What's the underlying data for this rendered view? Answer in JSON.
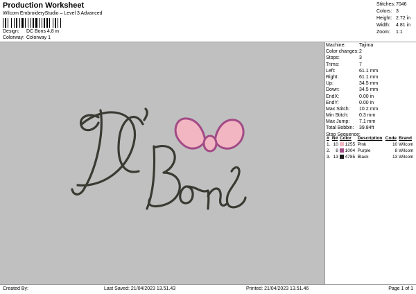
{
  "header": {
    "title": "Production Worksheet",
    "subtitle": "Wilcom EmbroideryStudio – Level 3 Advanced",
    "design_label": "Design:",
    "design_value": "DC Bons 4,8 in",
    "colorway_label": "Colorway:",
    "colorway_value": "Colorway 1"
  },
  "stats": [
    {
      "label": "Stitches:",
      "value": "7046"
    },
    {
      "label": "Colors:",
      "value": "3"
    },
    {
      "label": "Height:",
      "value": "2.72 in"
    },
    {
      "label": "Width:",
      "value": "4.81 in"
    },
    {
      "label": "Zoom:",
      "value": "1:1"
    }
  ],
  "properties": [
    {
      "label": "Machine:",
      "value": "Tajima"
    },
    {
      "label": "Color changes:",
      "value": "2"
    },
    {
      "label": "Stops:",
      "value": "3"
    },
    {
      "label": "Trims:",
      "value": "7"
    },
    {
      "label": "Left:",
      "value": "61.1 mm"
    },
    {
      "label": "Right:",
      "value": "61.1 mm"
    },
    {
      "label": "Up:",
      "value": "34.5 mm"
    },
    {
      "label": "Down:",
      "value": "34.5 mm"
    },
    {
      "label": "EndX:",
      "value": "0.00 in"
    },
    {
      "label": "EndY:",
      "value": "0.00 in"
    },
    {
      "label": "Max Stitch:",
      "value": "10.2 mm"
    },
    {
      "label": "Min Stitch:",
      "value": "0.3 mm"
    },
    {
      "label": "Max Jump:",
      "value": "7.1 mm"
    },
    {
      "label": "Total Bobbin:",
      "value": "39.84ft"
    }
  ],
  "stop_sequence": {
    "title": "Stop Sequence:",
    "headers": {
      "num": "#",
      "n": "N#",
      "color": "Color",
      "description": "Description",
      "code": "Code",
      "brand": "Brand"
    },
    "rows": [
      {
        "num": "1.",
        "n": "10",
        "swatch": "#f2b6c2",
        "color": "1255",
        "description": "Pink",
        "code": "10",
        "brand": "Wilcom"
      },
      {
        "num": "2.",
        "n": "8",
        "swatch": "#a24b86",
        "color": "1004",
        "description": "Purple",
        "code": "8",
        "brand": "Wilcom"
      },
      {
        "num": "3.",
        "n": "13",
        "swatch": "#1c1c1c",
        "color": "4785",
        "description": "Black",
        "code": "13",
        "brand": "Wilcom"
      }
    ]
  },
  "footer": {
    "created_by": "Created By:",
    "last_saved": "Last Saved: 21/04/2023 13.51.43",
    "printed": "Printed: 21/04/2023 13.51.46",
    "page": "Page 1 of 1"
  },
  "design_colors": {
    "thread": "#3a3a33",
    "bow_fill": "#f2b6c2",
    "bow_outline": "#a24b86",
    "canvas": "#c0c0c0"
  }
}
